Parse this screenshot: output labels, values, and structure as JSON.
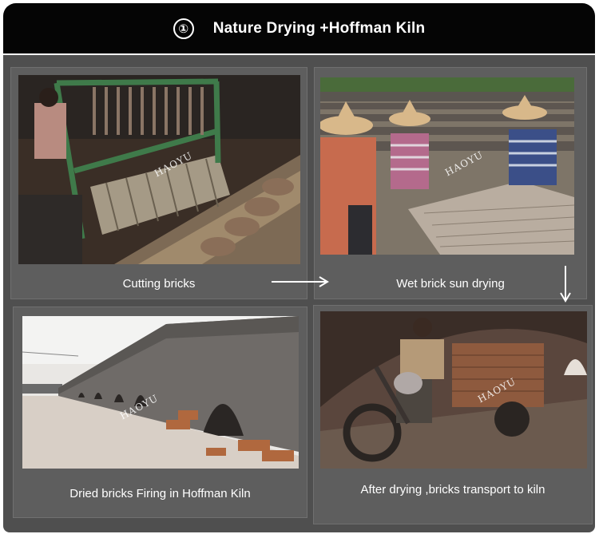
{
  "header": {
    "step_number": "①",
    "title": "Nature Drying +Hoffman Kiln"
  },
  "watermark": "HAOYU",
  "panels": [
    {
      "caption": "Cutting bricks"
    },
    {
      "caption": "Wet brick sun drying"
    },
    {
      "caption": "Dried bricks Firing in Hoffman Kiln"
    },
    {
      "caption": "After drying ,bricks transport to kiln"
    }
  ],
  "colors": {
    "header_bg": "#050505",
    "board_bg": "#4f4f4f",
    "panel_bg": "#5e5e5e",
    "text": "#ffffff"
  }
}
